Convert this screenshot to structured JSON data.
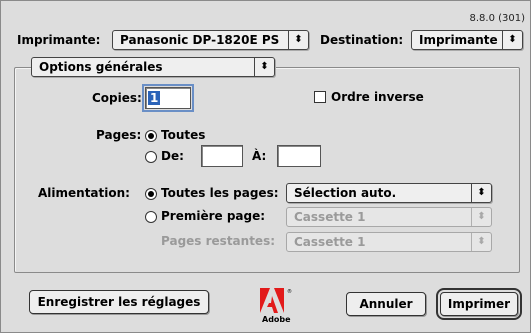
{
  "version": "8.8.0 (301)",
  "header": {
    "printer_label": "Imprimante:",
    "printer_value": "Panasonic DP-1820E PS",
    "destination_label": "Destination:",
    "destination_value": "Imprimante"
  },
  "panel_menu": {
    "value": "Options générales"
  },
  "copies": {
    "label": "Copies:",
    "value": "1"
  },
  "reverse_order": {
    "label": "Ordre inverse",
    "checked": false
  },
  "pages": {
    "label": "Pages:",
    "all_label": "Toutes",
    "from_label": "De:",
    "to_label": "À:",
    "selected": "all",
    "from_value": "",
    "to_value": ""
  },
  "paper_source": {
    "label": "Alimentation:",
    "all_pages_label": "Toutes les pages:",
    "all_pages_value": "Sélection auto.",
    "first_page_label": "Première page:",
    "first_page_value": "Cassette 1",
    "remaining_label": "Pages restantes:",
    "remaining_value": "Cassette 1",
    "selected": "all_pages"
  },
  "footer": {
    "save_settings": "Enregistrer les réglages",
    "cancel": "Annuler",
    "print": "Imprimer",
    "logo_text": "Adobe"
  },
  "colors": {
    "dialog_bg": "#dddddd",
    "selection": "#2b63b8",
    "logo_red": "#e21a1a"
  },
  "icons": {
    "popup_arrows": "up-down-arrows-icon",
    "logo": "adobe-logo-icon"
  }
}
